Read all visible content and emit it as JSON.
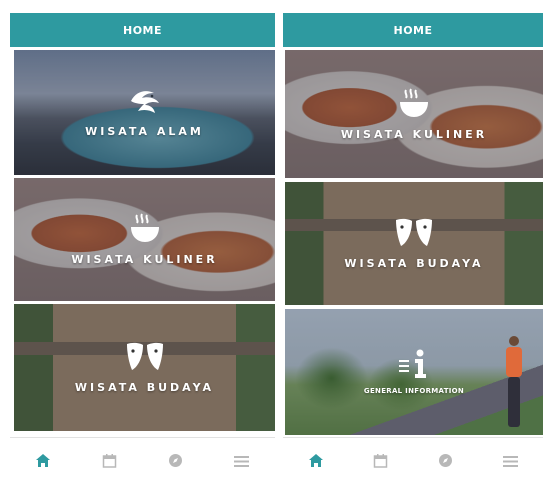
{
  "colors": {
    "header_bg": "#2e9aa0",
    "tab_active": "#2e9aa0",
    "tab_inactive": "#b8b8b8"
  },
  "left": {
    "header": {
      "title": "HOME"
    },
    "cards": [
      {
        "label": "WISATA ALAM",
        "icon": "bird-icon"
      },
      {
        "label": "WISATA KULINER",
        "icon": "bowl-icon"
      },
      {
        "label": "WISATA BUDAYA",
        "icon": "masks-icon"
      }
    ]
  },
  "right": {
    "header": {
      "title": "HOME"
    },
    "cards": [
      {
        "label": "WISATA KULINER",
        "icon": "bowl-icon"
      },
      {
        "label": "WISATA BUDAYA",
        "icon": "masks-icon"
      },
      {
        "label": "GENERAL INFORMATION",
        "icon": "info-icon"
      }
    ]
  },
  "tabbar": {
    "tabs": [
      {
        "name": "home",
        "icon": "home-icon",
        "active": true
      },
      {
        "name": "calendar",
        "icon": "calendar-icon",
        "active": false
      },
      {
        "name": "compass",
        "icon": "compass-icon",
        "active": false
      },
      {
        "name": "menu",
        "icon": "menu-icon",
        "active": false
      }
    ]
  }
}
